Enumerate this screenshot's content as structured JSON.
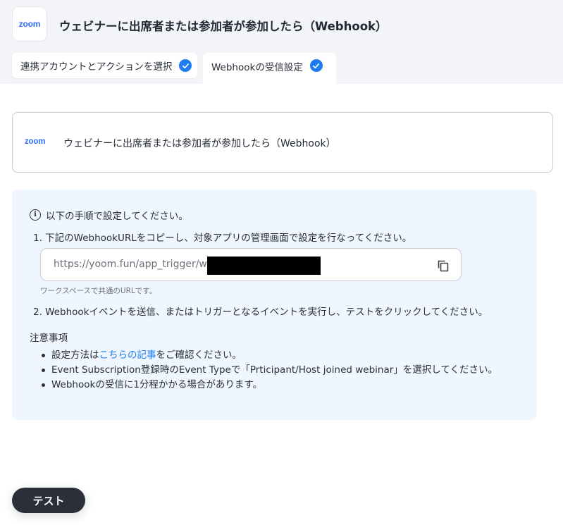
{
  "header": {
    "logo": "zoom",
    "title": "ウェビナーに出席者または参加者が参加したら（Webhook）"
  },
  "tabs": [
    {
      "label": "連携アカウントとアクションを選択",
      "status": "check-circle-icon"
    },
    {
      "label": "Webhookの受信設定",
      "status": "check-circle-icon"
    }
  ],
  "app_card": {
    "logo": "zoom",
    "title": "ウェビナーに出席者または参加者が参加したら（Webhook）"
  },
  "instructions": {
    "intro": "以下の手順で設定してください。",
    "step1": "1. 下記のWebhookURLをコピーし、対象アプリの管理画面で設定を行なってください。",
    "url": "https://yoom.fun/app_trigger/web",
    "url_hint": "ワークスペースで共通のURLです。",
    "step2": "2. Webhookイベントを送信、またはトリガーとなるイベントを実行し、テストをクリックしてください。"
  },
  "notes": {
    "title": "注意事項",
    "item1_before": "設定方法は",
    "item1_link": "こちらの記事",
    "item1_after": "をご確認ください。",
    "item2": "Event Subscription登録時のEvent Typeで「Prticipant/Host joined webinar」を選択してください。",
    "item3": "Webhookの受信に1分程かかる場合があります。"
  },
  "test_button": "テスト",
  "colors": {
    "accent": "#1f7cf0",
    "panel_bg": "#eff6ff",
    "header_bg": "#f2f4f7",
    "button_bg": "#2a2f3a"
  }
}
